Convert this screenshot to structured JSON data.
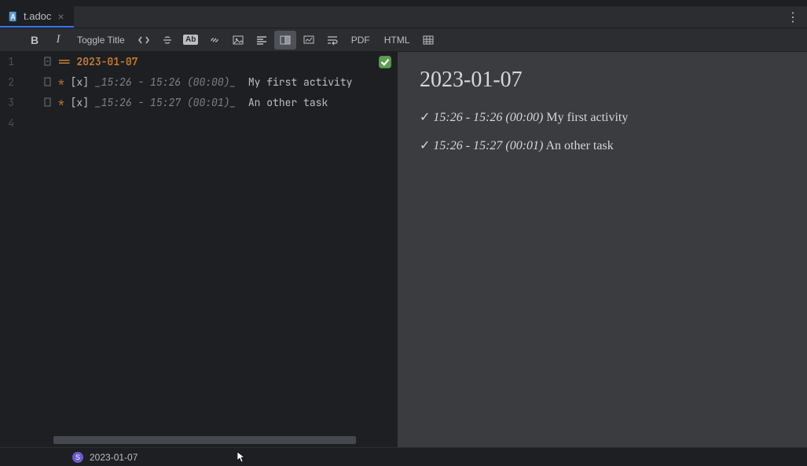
{
  "tab": {
    "filename": "t.adoc"
  },
  "toolbar": {
    "bold": "B",
    "italic": "I",
    "toggleTitle": "Toggle Title",
    "mono": "Ab",
    "pdf": "PDF",
    "html": "HTML"
  },
  "editor": {
    "lines": [
      {
        "num": "1",
        "heading_marker": "==",
        "heading_text": "2023-01-07"
      },
      {
        "num": "2",
        "bullet": "*",
        "checkbox": "[x]",
        "time": "_15:26 - 15:26 (00:00)_",
        "text": "My first activity"
      },
      {
        "num": "3",
        "bullet": "*",
        "checkbox": "[x]",
        "time": "_15:26 - 15:27 (00:01)_",
        "text": "An other task"
      },
      {
        "num": "4"
      }
    ]
  },
  "preview": {
    "title": "2023-01-07",
    "items": [
      {
        "check": "✓",
        "time": "15:26 - 15:26 (00:00)",
        "text": "My first activity"
      },
      {
        "check": "✓",
        "time": "15:26 - 15:27 (00:01)",
        "text": "An other task"
      }
    ]
  },
  "breadcrumb": {
    "badge": "S",
    "text": "2023-01-07"
  }
}
